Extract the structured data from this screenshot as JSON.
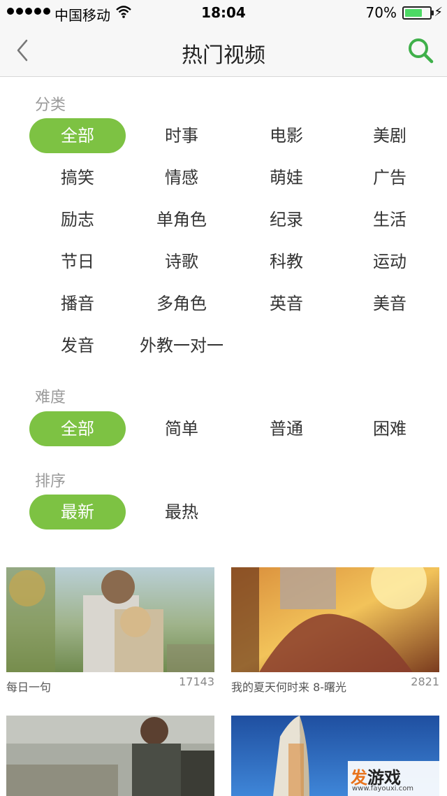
{
  "status_bar": {
    "carrier": "中国移动",
    "time": "18:04",
    "battery": "70%",
    "battery_level": 0.7
  },
  "nav": {
    "title": "热门视频"
  },
  "sections": {
    "category": {
      "label": "分类",
      "options": [
        "全部",
        "时事",
        "电影",
        "美剧",
        "搞笑",
        "情感",
        "萌娃",
        "广告",
        "励志",
        "单角色",
        "纪录",
        "生活",
        "节日",
        "诗歌",
        "科教",
        "运动",
        "播音",
        "多角色",
        "英音",
        "美音",
        "发音",
        "外教一对一"
      ],
      "selected": "全部"
    },
    "difficulty": {
      "label": "难度",
      "options": [
        "全部",
        "简单",
        "普通",
        "困难"
      ],
      "selected": "全部"
    },
    "sort": {
      "label": "排序",
      "options": [
        "最新",
        "最热"
      ],
      "selected": "最新"
    }
  },
  "videos": [
    {
      "title": "每日一句",
      "count": "17143"
    },
    {
      "title": "我的夏天何时来 8-曙光",
      "count": "2821"
    },
    {
      "title": "",
      "count": ""
    },
    {
      "title": "",
      "count": ""
    }
  ],
  "watermark": {
    "brand_accent": "发",
    "brand_rest": "游戏",
    "url": "www.fayouxi.com"
  },
  "colors": {
    "accent_green": "#7dc243",
    "search_icon": "#3fb04a"
  }
}
